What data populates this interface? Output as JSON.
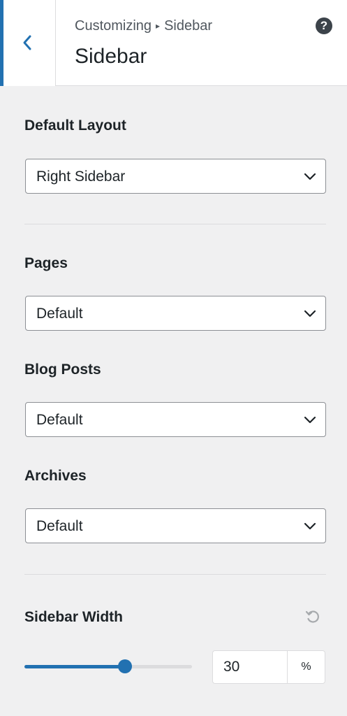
{
  "header": {
    "breadcrumb_prefix": "Customizing",
    "breadcrumb_separator": "▸",
    "breadcrumb_section": "Sidebar",
    "title": "Sidebar",
    "help_label": "?"
  },
  "fields": {
    "default_layout": {
      "label": "Default Layout",
      "value": "Right Sidebar"
    },
    "pages": {
      "label": "Pages",
      "value": "Default"
    },
    "blog_posts": {
      "label": "Blog Posts",
      "value": "Default"
    },
    "archives": {
      "label": "Archives",
      "value": "Default"
    },
    "sidebar_width": {
      "label": "Sidebar Width",
      "value": "30",
      "unit": "%",
      "slider_fraction": 0.6
    }
  },
  "colors": {
    "accent": "#2271b1",
    "background": "#f0f0f1"
  }
}
